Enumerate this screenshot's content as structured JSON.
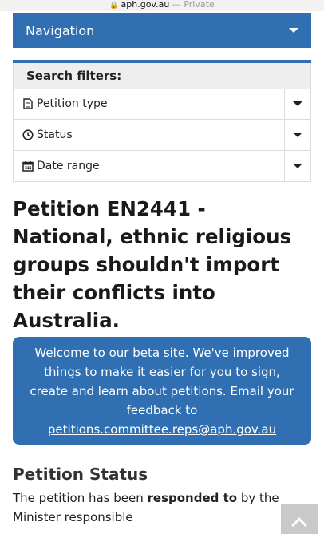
{
  "browser": {
    "url": "aph.gov.au",
    "separator": " — ",
    "private_label": "Private"
  },
  "nav": {
    "label": "Navigation"
  },
  "filters": {
    "heading": "Search filters:",
    "items": [
      {
        "icon": "document-icon",
        "label": "Petition type"
      },
      {
        "icon": "clock-icon",
        "label": "Status"
      },
      {
        "icon": "calendar-icon",
        "label": "Date range"
      }
    ]
  },
  "petition": {
    "title": "Petition EN2441 - National, ethnic religious groups shouldn't import their conflicts into Australia."
  },
  "beta": {
    "text": "Welcome to our beta site. We've improved things to make it easier for you to sign, create and learn about petitions. Email your feedback to",
    "email": "petitions.committee.reps@aph.gov.au"
  },
  "status": {
    "heading": "Petition Status",
    "text_before": "The petition has been ",
    "text_bold": "responded to",
    "text_after": " by the Minister responsible"
  },
  "colors": {
    "brand_blue": "#2f6fb2",
    "filter_bg": "#eeeeee"
  }
}
